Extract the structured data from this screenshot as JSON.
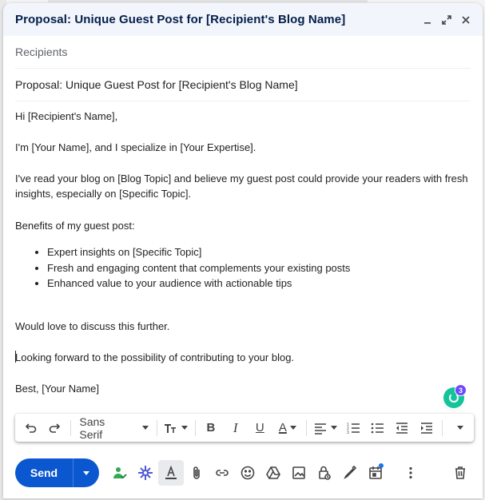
{
  "window": {
    "title": "Proposal: Unique Guest Post for [Recipient's Blog Name]"
  },
  "recipients": {
    "placeholder": "Recipients"
  },
  "subject": {
    "value": "Proposal: Unique Guest Post for [Recipient's Blog Name]"
  },
  "body": {
    "greeting": "Hi [Recipient's Name],",
    "intro": "I'm [Your Name], and I specialize in [Your Expertise].",
    "para": "I've read your blog on [Blog Topic] and believe my guest post could provide your readers with fresh insights, especially on [Specific Topic].",
    "benefits_heading": "Benefits of my guest post:",
    "benefits": [
      "Expert insights on [Specific Topic]",
      "Fresh and engaging content that complements your existing posts",
      "Enhanced value to your audience with actionable tips"
    ],
    "discuss": "Would love to discuss this further.",
    "looking": "Looking forward to the possibility of contributing to your blog.",
    "signoff": "Best, [Your Name]"
  },
  "grammarly": {
    "count": "3"
  },
  "toolbar": {
    "font": "Sans Serif",
    "text_color_glyph": "A",
    "italic_glyph": "I",
    "bold_glyph": "B",
    "underline_glyph": "U"
  },
  "send": {
    "label": "Send"
  },
  "colors": {
    "send": "#0b57d0",
    "header": "#f2f6fc",
    "grammarly": "#15c39a"
  }
}
